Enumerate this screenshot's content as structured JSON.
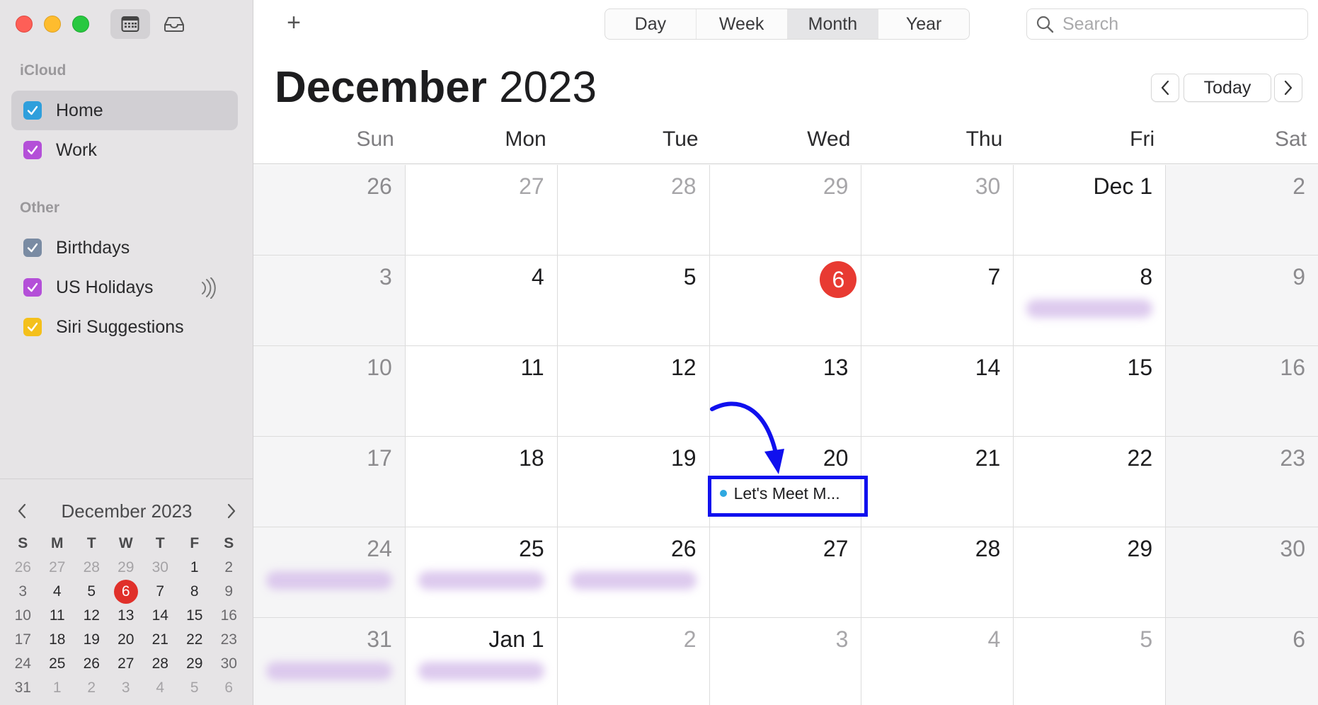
{
  "toolbar": {
    "add_label": "+",
    "views": [
      "Day",
      "Week",
      "Month",
      "Year"
    ],
    "active_view": "Month",
    "search_placeholder": "Search"
  },
  "header": {
    "month": "December",
    "year": "2023",
    "today_label": "Today"
  },
  "sidebar": {
    "icloud_label": "iCloud",
    "other_label": "Other",
    "calendars": [
      {
        "name": "Home",
        "color": "#2f9fdc",
        "selected": true
      },
      {
        "name": "Work",
        "color": "#b44fd8"
      }
    ],
    "other_calendars": [
      {
        "name": "Birthdays",
        "color": "#7a8ba3"
      },
      {
        "name": "US Holidays",
        "color": "#b44fd8"
      },
      {
        "name": "Siri Suggestions",
        "color": "#f4c01b"
      }
    ]
  },
  "mini_calendar": {
    "title": "December 2023",
    "dow": [
      "S",
      "M",
      "T",
      "W",
      "T",
      "F",
      "S"
    ],
    "weeks": [
      [
        "26",
        "27",
        "28",
        "29",
        "30",
        "1",
        "2"
      ],
      [
        "3",
        "4",
        "5",
        "6",
        "7",
        "8",
        "9"
      ],
      [
        "10",
        "11",
        "12",
        "13",
        "14",
        "15",
        "16"
      ],
      [
        "17",
        "18",
        "19",
        "20",
        "21",
        "22",
        "23"
      ],
      [
        "24",
        "25",
        "26",
        "27",
        "28",
        "29",
        "30"
      ],
      [
        "31",
        "1",
        "2",
        "3",
        "4",
        "5",
        "6"
      ]
    ],
    "today": "6"
  },
  "weekdays": [
    "Sun",
    "Mon",
    "Tue",
    "Wed",
    "Thu",
    "Fri",
    "Sat"
  ],
  "month_grid": [
    [
      "26",
      "27",
      "28",
      "29",
      "30",
      "Dec 1",
      "2"
    ],
    [
      "3",
      "4",
      "5",
      "6",
      "7",
      "8",
      "9"
    ],
    [
      "10",
      "11",
      "12",
      "13",
      "14",
      "15",
      "16"
    ],
    [
      "17",
      "18",
      "19",
      "20",
      "21",
      "22",
      "23"
    ],
    [
      "24",
      "25",
      "26",
      "27",
      "28",
      "29",
      "30"
    ],
    [
      "31",
      "Jan 1",
      "2",
      "3",
      "4",
      "5",
      "6"
    ]
  ],
  "event": {
    "title": "Let's Meet M...",
    "day": "20",
    "color": "#2fa8e0"
  },
  "colors": {
    "today": "#e83a32",
    "highlight": "#1010ee",
    "blurred_event": "#d9c4ec"
  }
}
